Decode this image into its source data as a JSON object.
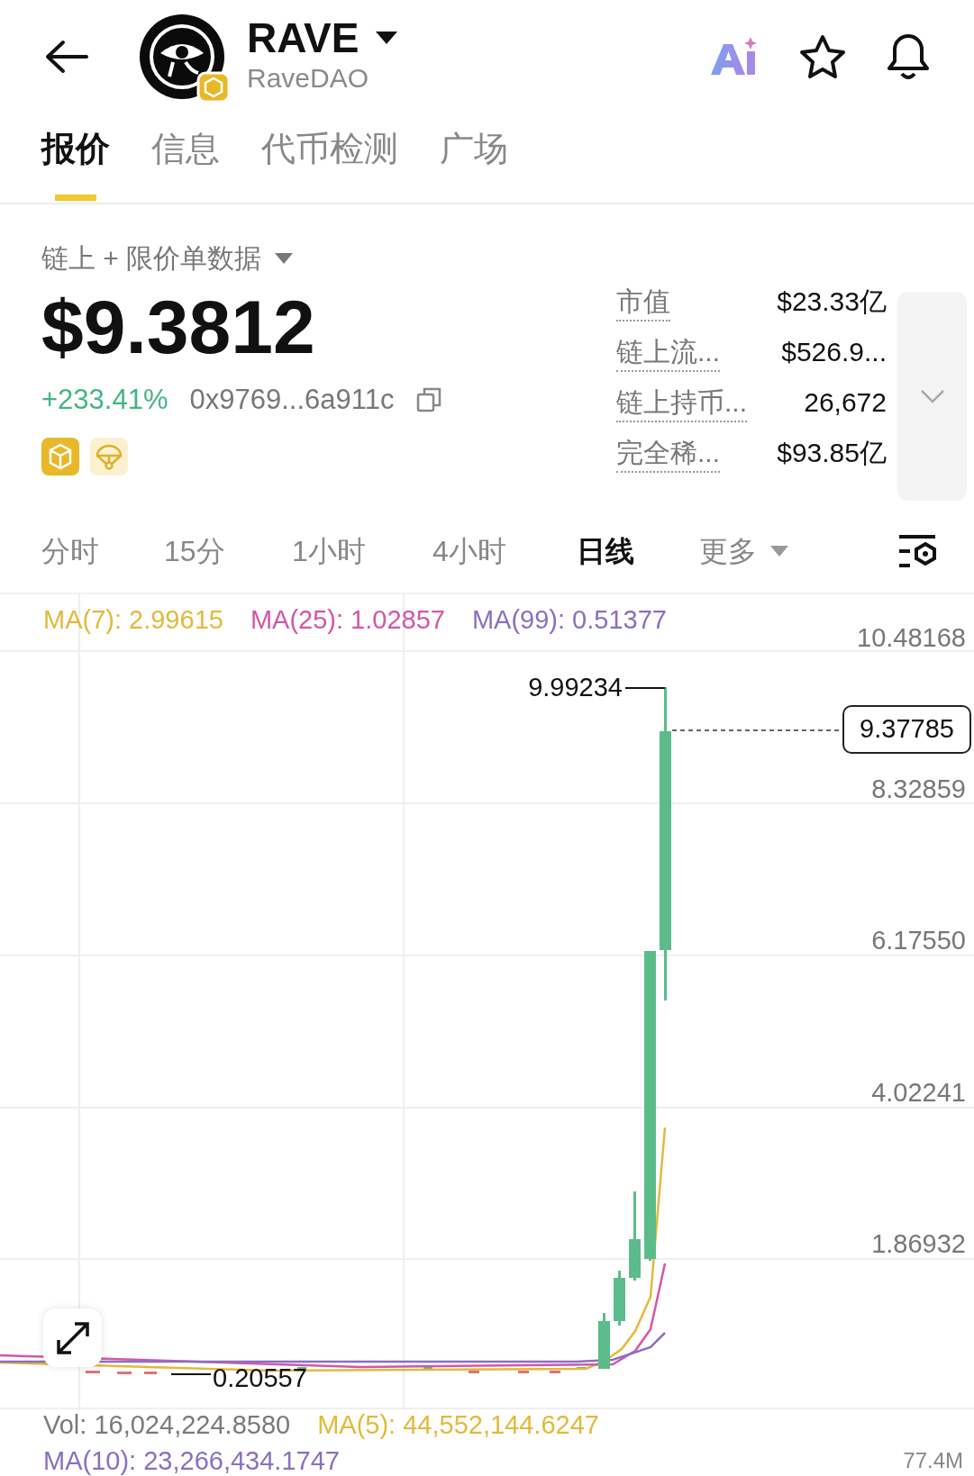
{
  "header": {
    "symbol": "RAVE",
    "name": "RaveDAO"
  },
  "tabs": [
    {
      "label": "报价",
      "selected": true
    },
    {
      "label": "信息",
      "selected": false
    },
    {
      "label": "代币检测",
      "selected": false
    },
    {
      "label": "广场",
      "selected": false
    }
  ],
  "source_selector": "链上 + 限价单数据",
  "price": "$9.3812",
  "change": "+233.41%",
  "address": "0x9769...6a911c",
  "stats": [
    {
      "label": "市值",
      "value": "$23.33亿"
    },
    {
      "label": "链上流...",
      "value": "$526.9..."
    },
    {
      "label": "链上持币...",
      "value": "26,672"
    },
    {
      "label": "完全稀...",
      "value": "$93.85亿"
    }
  ],
  "intervals": [
    {
      "label": "分时",
      "selected": false,
      "kind": "plain"
    },
    {
      "label": "15分",
      "selected": false,
      "kind": "plain"
    },
    {
      "label": "1小时",
      "selected": false,
      "kind": "plain"
    },
    {
      "label": "4小时",
      "selected": false,
      "kind": "plain"
    },
    {
      "label": "日线",
      "selected": true,
      "kind": "plain"
    },
    {
      "label": "更多",
      "selected": false,
      "kind": "dropdown"
    }
  ],
  "chart": {
    "indicators": [
      {
        "text": "MA(7): 2.99615",
        "color": "#e2b93b"
      },
      {
        "text": "MA(25): 1.02857",
        "color": "#d356a8"
      },
      {
        "text": "MA(99): 0.51377",
        "color": "#8a6fc0"
      }
    ],
    "y_labels": [
      "10.48168",
      "8.32859",
      "6.17550",
      "4.02241",
      "1.86932"
    ],
    "high_label": "9.99234",
    "low_label": "0.20557",
    "current_price": "9.37785"
  },
  "volume": {
    "indicators": [
      {
        "text": "Vol: 16,024,224.8580",
        "color": "#7a7a7a"
      },
      {
        "text": "MA(5): 44,552,144.6247",
        "color": "#e2b93b"
      },
      {
        "text": "MA(10): 23,266,434.1747",
        "color": "#8a6fc0"
      }
    ],
    "axis_label": "77.4M"
  }
}
